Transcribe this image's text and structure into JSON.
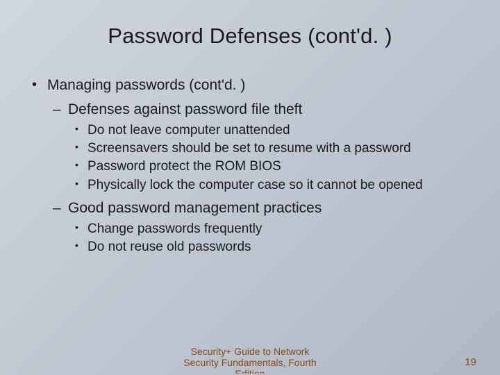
{
  "title": "Password Defenses (cont'd. )",
  "content": {
    "lvl1": {
      "item0": "Managing passwords (cont'd. )"
    },
    "lvl2": {
      "item0": "Defenses against password file theft",
      "item1": "Good password management practices"
    },
    "lvl3a": {
      "item0": "Do not leave computer unattended",
      "item1": "Screensavers should be set to resume with a password",
      "item2": "Password protect the ROM BIOS",
      "item3": "Physically lock the computer case so it cannot be opened"
    },
    "lvl3b": {
      "item0": "Change passwords frequently",
      "item1": "Do not reuse old passwords"
    }
  },
  "footer": {
    "line1": "Security+ Guide to Network",
    "line2": "Security Fundamentals, Fourth",
    "line3": "Edition",
    "page": "19"
  }
}
